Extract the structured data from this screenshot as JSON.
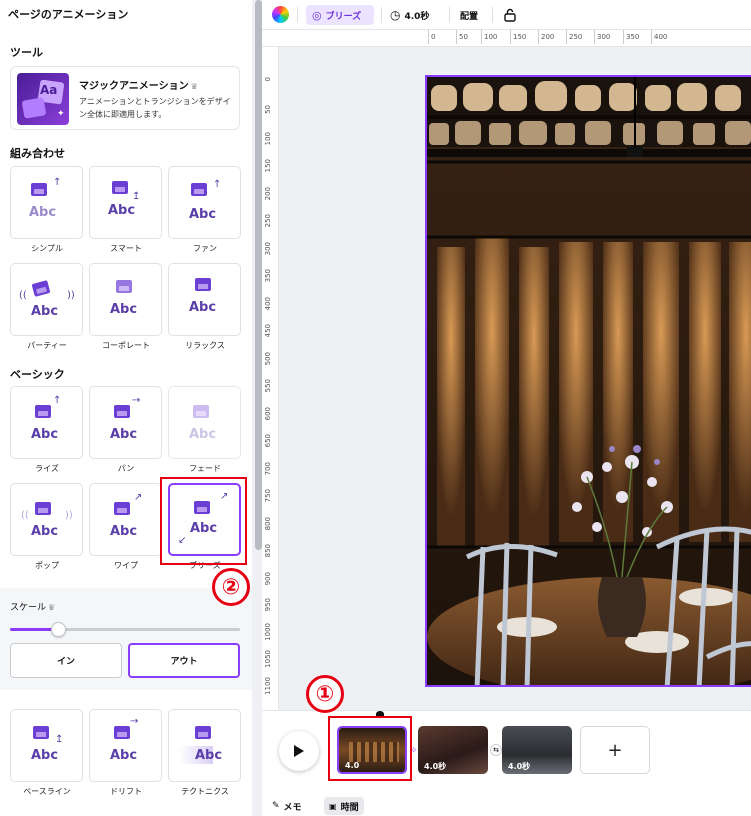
{
  "panel": {
    "title": "ページのアニメーション",
    "tools_title": "ツール",
    "magic": {
      "name": "マジックアニメーション",
      "desc": "アニメーションとトランジションをデザイン全体に即適用します。",
      "thumb_text": "Aa"
    },
    "combo_title": "組み合わせ",
    "combo": [
      "シンプル",
      "スマート",
      "ファン",
      "パーティー",
      "コーポレート",
      "リラックス"
    ],
    "basic_title": "ベーシック",
    "basic": [
      "ライズ",
      "パン",
      "フェード",
      "ポップ",
      "ワイプ",
      "ブリーズ"
    ],
    "abc": "Abc",
    "scale": {
      "label": "スケール",
      "value": 0.21,
      "in_label": "イン",
      "out_label": "アウト"
    },
    "more": [
      "ベースライン",
      "ドリフト",
      "テクトニクス"
    ]
  },
  "toolbar": {
    "breeze": "ブリーズ",
    "duration": "4.0秒",
    "arrange": "配置"
  },
  "ruler_top": [
    "0",
    "50",
    "100",
    "150",
    "200",
    "250",
    "300",
    "350",
    "400"
  ],
  "ruler_left": [
    "0",
    "50",
    "100",
    "150",
    "200",
    "250",
    "300",
    "350",
    "400",
    "450",
    "500",
    "550",
    "600",
    "650",
    "700",
    "750",
    "800",
    "850",
    "900",
    "950",
    "1000",
    "1050",
    "1100"
  ],
  "timeline": {
    "clips": [
      "4.0",
      "4.0秒",
      "4.0秒"
    ],
    "memo": "メモ",
    "time": "時間",
    "add": "+"
  },
  "annotations": {
    "one": "①",
    "two": "②"
  },
  "colors": {
    "accent": "#8b3dff",
    "annotation": "#e60012"
  }
}
